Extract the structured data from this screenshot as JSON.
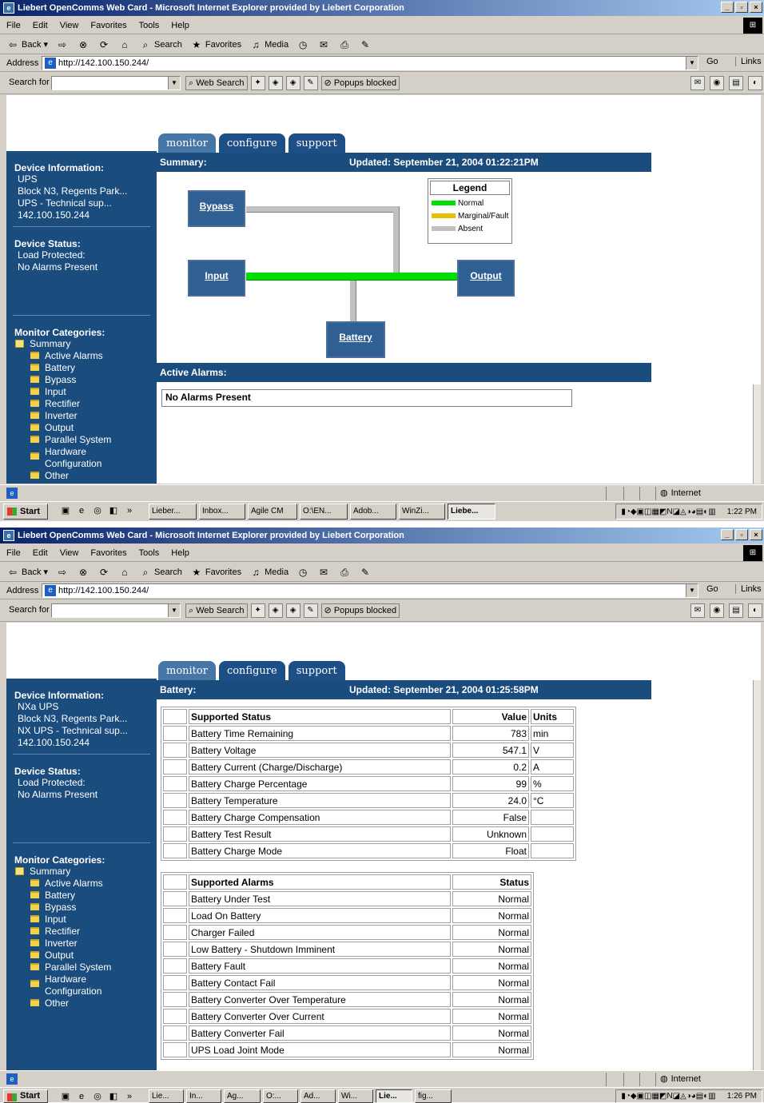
{
  "window_title": "Liebert OpenComms Web Card - Microsoft Internet Explorer provided by Liebert Corporation",
  "menu": [
    "File",
    "Edit",
    "View",
    "Favorites",
    "Tools",
    "Help"
  ],
  "toolbar": {
    "back": "Back",
    "search": "Search",
    "favorites": "Favorites",
    "media": "Media"
  },
  "address": {
    "label": "Address",
    "url": "http://142.100.150.244/",
    "go": "Go",
    "links": "Links"
  },
  "searchbar": {
    "label": "Search for",
    "web_search": "Web Search",
    "popups": "Popups blocked"
  },
  "tabs": [
    "monitor",
    "configure",
    "support"
  ],
  "screen1": {
    "device_info_title": "Device Information:",
    "device_info": [
      "UPS",
      "Block N3, Regents Park...",
      "UPS - Technical sup...",
      "142.100.150.244"
    ],
    "device_status_title": "Device Status:",
    "device_status": [
      "Load Protected:",
      "No Alarms Present"
    ],
    "summary_label": "Summary:",
    "updated": "Updated: September 21, 2004 01:22:21PM",
    "diagram": {
      "bypass": "Bypass",
      "input": "Input",
      "output": "Output",
      "battery": "Battery"
    },
    "legend": {
      "title": "Legend",
      "items": [
        {
          "label": "Normal",
          "color": "#00e000"
        },
        {
          "label": "Marginal/Fault",
          "color": "#e8c000"
        },
        {
          "label": "Absent",
          "color": "#c0c0c0"
        }
      ]
    },
    "active_alarms_label": "Active Alarms:",
    "no_alarms": "No Alarms Present",
    "tasks": [
      "Lieber...",
      "Inbox...",
      "Agile CM",
      "O:\\EN...",
      "Adob...",
      "WinZi...",
      "Liebe..."
    ],
    "clock": "1:22 PM"
  },
  "screen2": {
    "device_info_title": "Device Information:",
    "device_info": [
      "NXa UPS",
      "Block N3, Regents Park...",
      "NX UPS - Technical sup...",
      "142.100.150.244"
    ],
    "device_status_title": "Device Status:",
    "device_status": [
      "Load Protected:",
      "No Alarms Present"
    ],
    "battery_label": "Battery:",
    "updated": "Updated: September 21, 2004 01:25:58PM",
    "status_table": {
      "headers": [
        "Supported Status",
        "Value",
        "Units"
      ],
      "rows": [
        [
          "Battery Time Remaining",
          "783",
          "min"
        ],
        [
          "Battery Voltage",
          "547.1",
          "V"
        ],
        [
          "Battery Current (Charge/Discharge)",
          "0.2",
          "A"
        ],
        [
          "Battery Charge Percentage",
          "99",
          "%"
        ],
        [
          "Battery Temperature",
          "24.0",
          "°C"
        ],
        [
          "Battery Charge Compensation",
          "False",
          ""
        ],
        [
          "Battery Test Result",
          "Unknown",
          ""
        ],
        [
          "Battery Charge Mode",
          "Float",
          ""
        ]
      ]
    },
    "alarms_table": {
      "headers": [
        "Supported Alarms",
        "Status"
      ],
      "rows": [
        [
          "Battery Under Test",
          "Normal"
        ],
        [
          "Load On Battery",
          "Normal"
        ],
        [
          "Charger Failed",
          "Normal"
        ],
        [
          "Low Battery - Shutdown Imminent",
          "Normal"
        ],
        [
          "Battery Fault",
          "Normal"
        ],
        [
          "Battery Contact Fail",
          "Normal"
        ],
        [
          "Battery Converter Over Temperature",
          "Normal"
        ],
        [
          "Battery Converter Over Current",
          "Normal"
        ],
        [
          "Battery Converter Fail",
          "Normal"
        ],
        [
          "UPS Load Joint Mode",
          "Normal"
        ]
      ]
    },
    "tasks": [
      "Lie...",
      "In...",
      "Ag...",
      "O:...",
      "Ad...",
      "Wi...",
      "Lie...",
      "fig..."
    ],
    "clock": "1:26 PM"
  },
  "categories_title": "Monitor Categories:",
  "categories": [
    "Summary",
    "Active Alarms",
    "Battery",
    "Bypass",
    "Input",
    "Rectifier",
    "Inverter",
    "Output",
    "Parallel System",
    "Hardware Configuration",
    "Other"
  ],
  "status_zone": "Internet",
  "start": "Start"
}
